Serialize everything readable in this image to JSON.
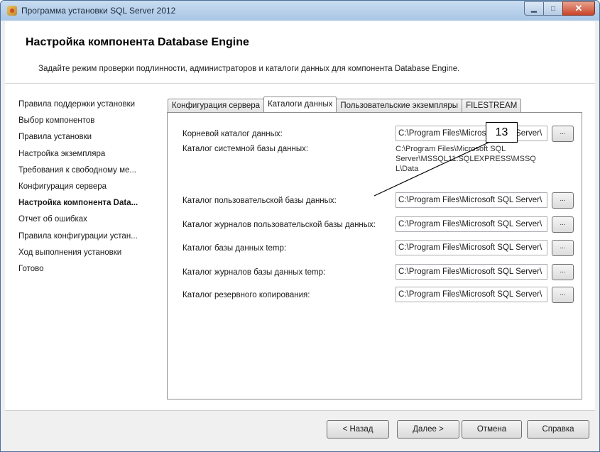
{
  "window": {
    "title": "Программа установки SQL Server 2012",
    "min_glyph": "▁",
    "max_glyph": "□",
    "close_glyph": "✕"
  },
  "header": {
    "title": "Настройка компонента Database Engine",
    "subtitle": "Задайте режим проверки подлинности, администраторов и каталоги данных для компонента Database Engine."
  },
  "nav": {
    "items": [
      {
        "label": "Правила поддержки установки"
      },
      {
        "label": "Выбор компонентов"
      },
      {
        "label": "Правила установки"
      },
      {
        "label": "Настройка экземпляра"
      },
      {
        "label": "Требования к свободному ме..."
      },
      {
        "label": "Конфигурация сервера"
      },
      {
        "label": "Настройка компонента Data..."
      },
      {
        "label": "Отчет об ошибках"
      },
      {
        "label": "Правила конфигурации устан..."
      },
      {
        "label": "Ход выполнения установки"
      },
      {
        "label": "Готово"
      }
    ]
  },
  "tabs": [
    {
      "label": "Конфигурация сервера"
    },
    {
      "label": "Каталоги данных"
    },
    {
      "label": "Пользовательские экземпляры"
    },
    {
      "label": "FILESTREAM"
    }
  ],
  "form": {
    "root_dir": {
      "label": "Корневой каталог данных:",
      "value": "C:\\Program Files\\Microsoft SQL Server\\"
    },
    "system_db_dir": {
      "label": "Каталог системной базы данных:",
      "value_lines": [
        "C:\\Program Files\\Microsoft SQL",
        "Server\\MSSQL11.SQLEXPRESS\\MSSQ",
        "L\\Data"
      ]
    },
    "user_db_dir": {
      "label": "Каталог пользовательской базы данных:",
      "value": "C:\\Program Files\\Microsoft SQL Server\\"
    },
    "user_log_dir": {
      "label": "Каталог журналов пользовательской базы данных:",
      "value": "C:\\Program Files\\Microsoft SQL Server\\"
    },
    "temp_db_dir": {
      "label": "Каталог базы данных temp:",
      "value": "C:\\Program Files\\Microsoft SQL Server\\"
    },
    "temp_log_dir": {
      "label": "Каталог журналов базы данных temp:",
      "value": "C:\\Program Files\\Microsoft SQL Server\\"
    },
    "backup_dir": {
      "label": "Каталог резервного копирования:",
      "value": "C:\\Program Files\\Microsoft SQL Server\\"
    },
    "browse_label": "..."
  },
  "callout": {
    "number": "13"
  },
  "footer": {
    "back": "< Назад",
    "next": "Далее >",
    "cancel": "Отмена",
    "help": "Справка"
  }
}
